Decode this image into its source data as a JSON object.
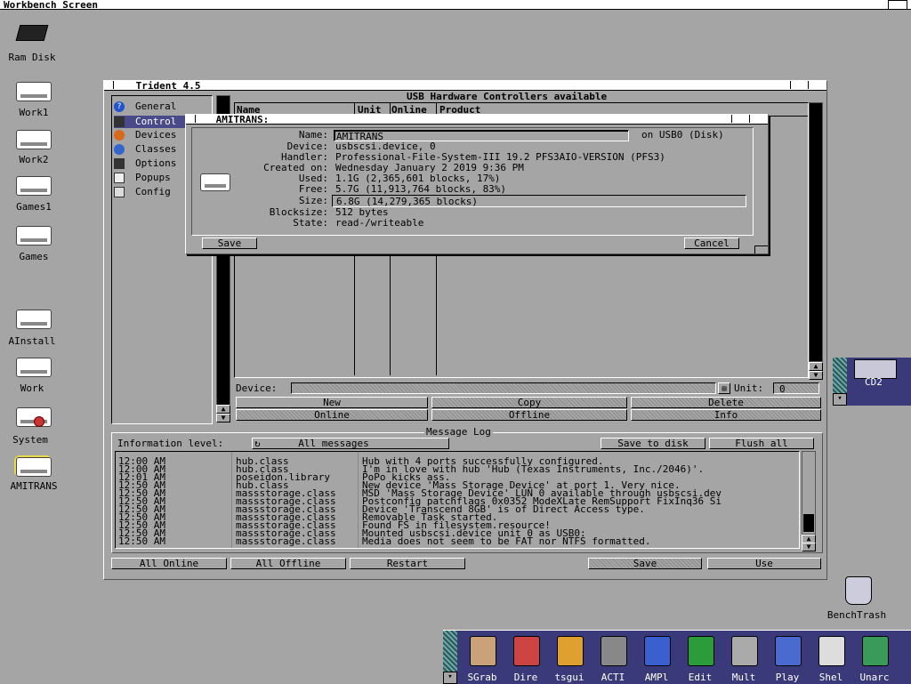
{
  "screen": {
    "title": "Workbench Screen"
  },
  "desktop_icons": [
    {
      "label": "Ram Disk"
    },
    {
      "label": "Work1"
    },
    {
      "label": "Work2"
    },
    {
      "label": "Games1"
    },
    {
      "label": "Games"
    },
    {
      "label": "AInstall"
    },
    {
      "label": "Work"
    },
    {
      "label": "System"
    },
    {
      "label": "AMITRANS"
    }
  ],
  "cd_icon": {
    "label": "CD2"
  },
  "trash": {
    "label": "BenchTrash"
  },
  "trident": {
    "title": "Trident 4.5",
    "sidebar": [
      {
        "label": "General",
        "icon": "question-icon"
      },
      {
        "label": "Control",
        "icon": "controller-icon"
      },
      {
        "label": "Devices",
        "icon": "device-icon"
      },
      {
        "label": "Classes",
        "icon": "classes-icon"
      },
      {
        "label": "Options",
        "icon": "options-icon"
      },
      {
        "label": "Popups",
        "icon": "popups-icon"
      },
      {
        "label": "Config",
        "icon": "config-icon"
      }
    ],
    "controllers_heading": "USB Hardware Controllers available",
    "columns": {
      "name": "Name",
      "unit": "Unit",
      "online": "Online",
      "product": "Product"
    },
    "device_label": "Device:",
    "unit_label": "Unit:",
    "unit_value": "0",
    "buttons_row1": [
      "New",
      "Copy",
      "Delete"
    ],
    "buttons_row2": [
      "Online",
      "Offline",
      "Info"
    ],
    "message_log": {
      "heading": "Message Log",
      "info_level_label": "Information level:",
      "info_level_value": "All messages",
      "save_to_disk": "Save to disk",
      "flush_all": "Flush all",
      "rows": [
        {
          "time": "12:00 AM",
          "source": "hub.class",
          "msg": "Hub with 4 ports successfully configured."
        },
        {
          "time": "12:00 AM",
          "source": "hub.class",
          "msg": "I'm in love with hub 'Hub (Texas Instruments, Inc./2046)'."
        },
        {
          "time": "12:01 AM",
          "source": "poseidon.library",
          "msg": "PoPo kicks ass."
        },
        {
          "time": "12:50 AM",
          "source": "hub.class",
          "msg": "New device 'Mass Storage Device' at port 1. Very nice."
        },
        {
          "time": "12:50 AM",
          "source": "massstorage.class",
          "msg": "MSD 'Mass Storage Device' LUN 0 available through usbscsi.dev"
        },
        {
          "time": "12:50 AM",
          "source": "massstorage.class",
          "msg": "Postconfig patchflags 0x0352 ModeXLate RemSupport FixInq36 Si"
        },
        {
          "time": "12:50 AM",
          "source": "massstorage.class",
          "msg": "Device 'Transcend 8GB' is of Direct Access type."
        },
        {
          "time": "12:50 AM",
          "source": "massstorage.class",
          "msg": "Removable Task started."
        },
        {
          "time": "12:50 AM",
          "source": "massstorage.class",
          "msg": "Found FS in filesystem.resource!"
        },
        {
          "time": "12:50 AM",
          "source": "massstorage.class",
          "msg": "Mounted usbscsi.device unit 0 as USB0:"
        },
        {
          "time": "12:50 AM",
          "source": "massstorage.class",
          "msg": "Media does not seem to be FAT nor NTFS formatted."
        }
      ]
    },
    "bottom_buttons": [
      "All Online",
      "All Offline",
      "Restart",
      "Save",
      "Use"
    ]
  },
  "amitrans": {
    "title": "AMITRANS:",
    "fields": {
      "name_label": "Name:",
      "name_value": "AMITRANS",
      "name_suffix": "on USB0 (Disk)",
      "device_label": "Device:",
      "device_value": "usbscsi.device, 0",
      "handler_label": "Handler:",
      "handler_value": "Professional-File-System-III 19.2 PFS3AIO-VERSION  (PFS3)",
      "created_label": "Created on:",
      "created_value": "Wednesday January  2 2019 9:36 PM",
      "used_label": "Used:",
      "used_value": "1.1G (2,365,601 blocks, 17%)",
      "free_label": "Free:",
      "free_value": "5.7G (11,913,764 blocks, 83%)",
      "size_label": "Size:",
      "size_value": "6.8G (14,279,365 blocks)",
      "blocksize_label": "Blocksize:",
      "blocksize_value": "512 bytes",
      "state_label": "State:",
      "state_value": "read-/writeable"
    },
    "save": "Save",
    "cancel": "Cancel"
  },
  "dock": [
    {
      "label": "SGrab"
    },
    {
      "label": "Dire"
    },
    {
      "label": "tsgui"
    },
    {
      "label": "ACTI"
    },
    {
      "label": "AMPl"
    },
    {
      "label": "Edit"
    },
    {
      "label": "Mult"
    },
    {
      "label": "Play"
    },
    {
      "label": "Shel"
    },
    {
      "label": "Unarc"
    }
  ]
}
